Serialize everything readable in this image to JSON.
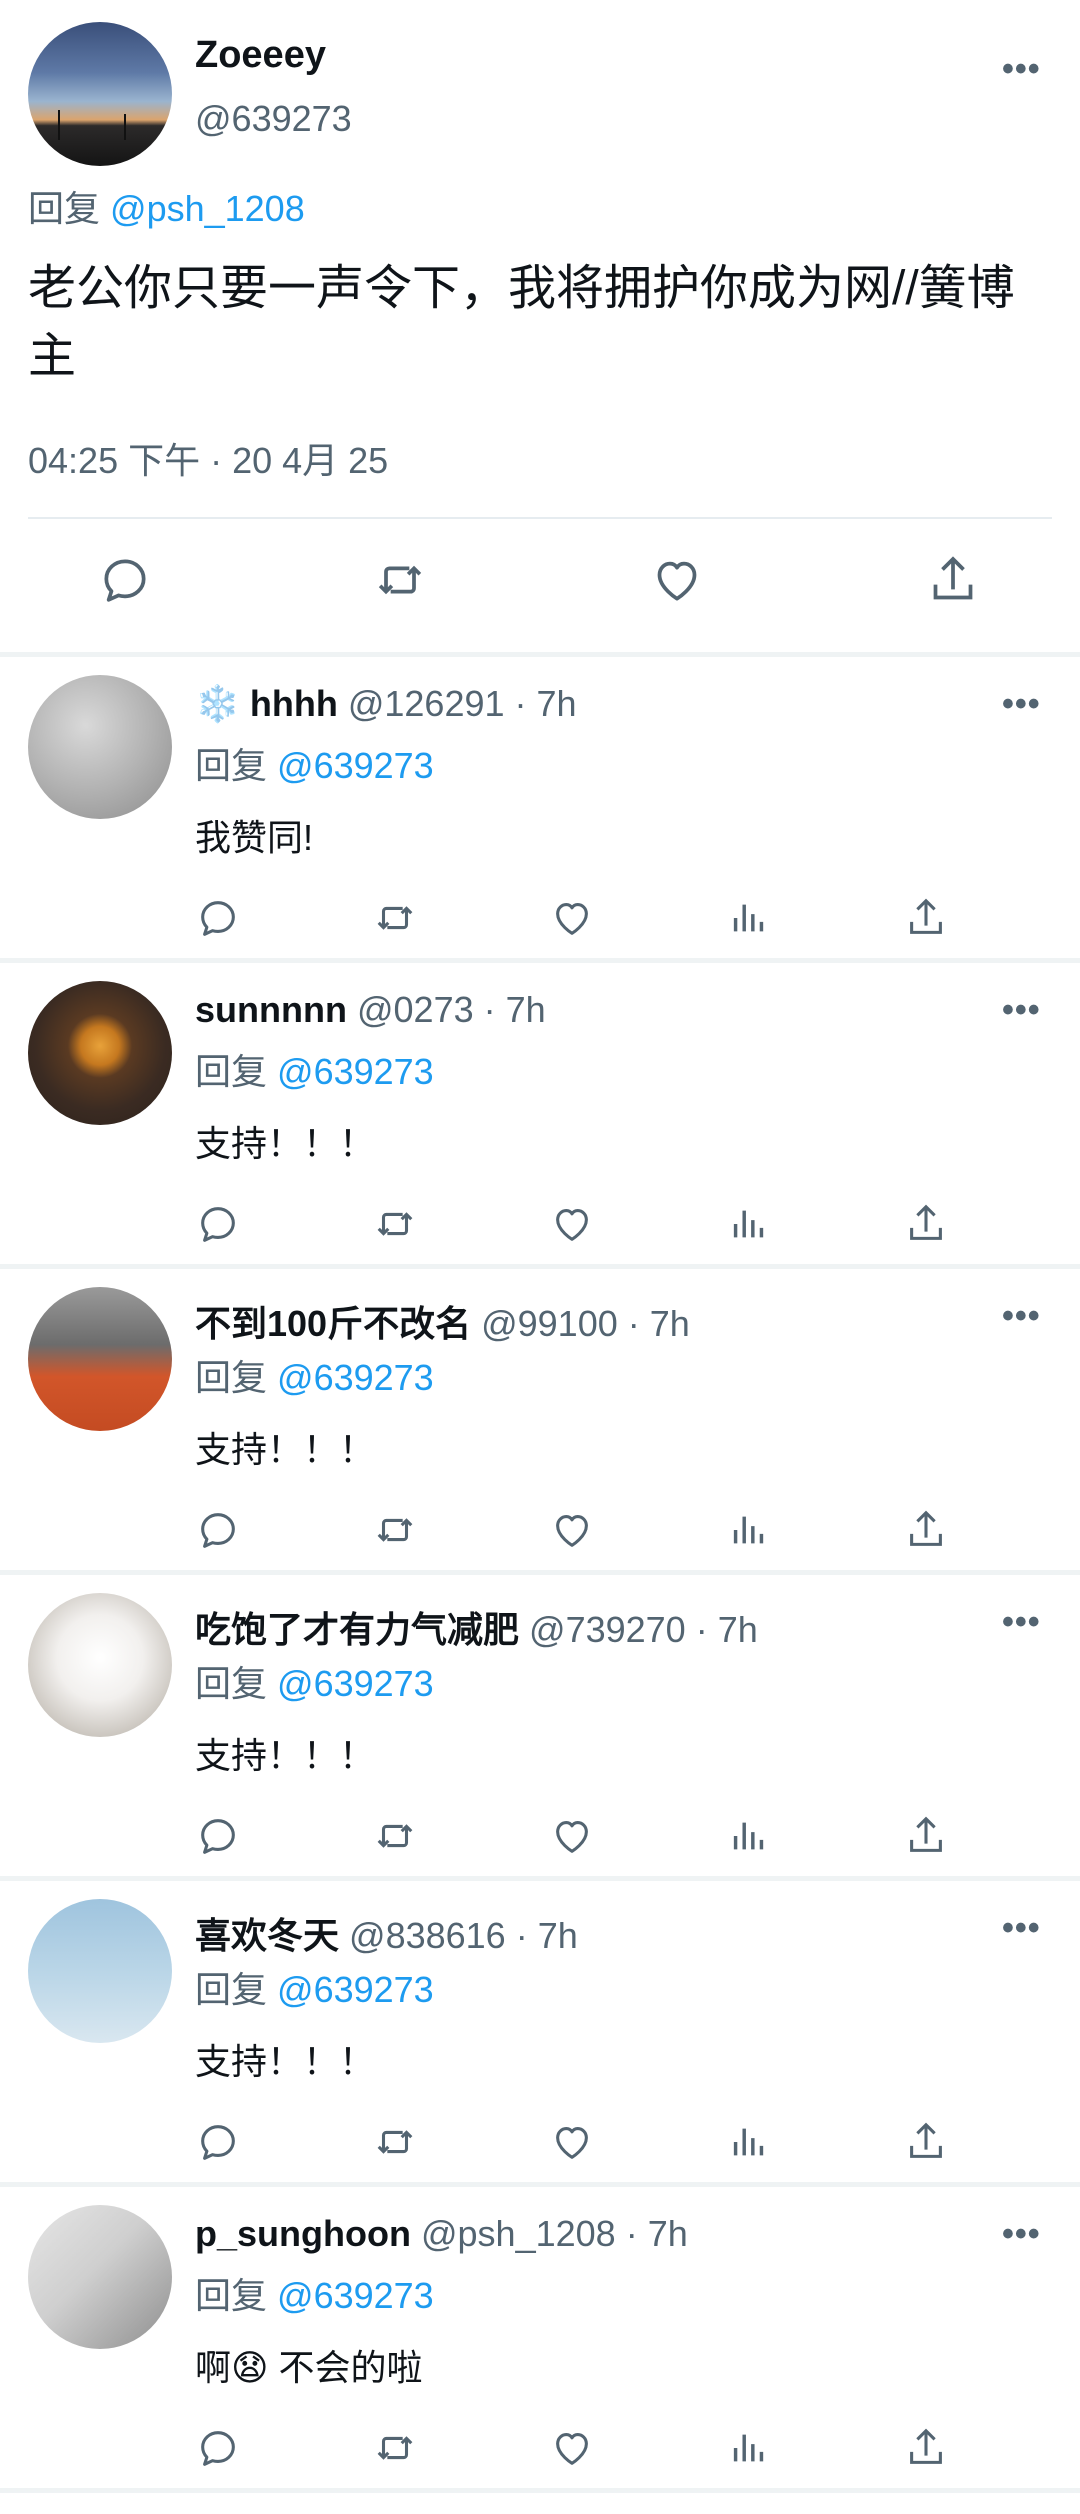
{
  "main_tweet": {
    "name": "Zoeeey",
    "handle": "@639273",
    "reply_prefix": "回复",
    "reply_to": "@psh_1208",
    "text": "老公你只要一声令下，我将拥护你成为网//簧博主",
    "timestamp": "04:25 下午 · 20 4月 25",
    "more_label": "•••"
  },
  "replies": [
    {
      "icon_prefix": "❄️",
      "name": "hhhh",
      "handle": "@126291",
      "time": "· 7h",
      "reply_prefix": "回复",
      "reply_to": "@639273",
      "text": "我赞同!",
      "more_label": "•••"
    },
    {
      "icon_prefix": "",
      "name": "sunnnnn",
      "handle": "@0273",
      "time": "· 7h",
      "reply_prefix": "回复",
      "reply_to": "@639273",
      "text": "支持！！！",
      "more_label": "•••"
    },
    {
      "icon_prefix": "",
      "name": "不到100斤不改名",
      "handle": "@99100",
      "time": "· 7h",
      "reply_prefix": "回复",
      "reply_to": "@639273",
      "text": "支持！！！",
      "more_label": "•••"
    },
    {
      "icon_prefix": "",
      "name": "吃饱了才有力气减肥",
      "handle": "@739270",
      "time": "· 7h",
      "reply_prefix": "回复",
      "reply_to": "@639273",
      "text": "支持！！！",
      "more_label": "•••"
    },
    {
      "icon_prefix": "",
      "name": "喜欢冬天",
      "handle": "@838616",
      "time": "· 7h",
      "reply_prefix": "回复",
      "reply_to": "@639273",
      "text": "支持！！！",
      "more_label": "•••"
    },
    {
      "icon_prefix": "",
      "name": "p_sunghoon",
      "handle": "@psh_1208",
      "time": "· 7h",
      "reply_prefix": "回复",
      "reply_to": "@639273",
      "text": "啊😧 不会的啦",
      "more_label": "•••"
    }
  ],
  "icons": {
    "reply": "reply-icon",
    "retweet": "retweet-icon",
    "like": "heart-icon",
    "views": "views-icon",
    "share": "share-icon",
    "more": "more-icon"
  },
  "colors": {
    "link": "#1d9bf0",
    "secondary_text": "#536471",
    "divider": "#eff3f4"
  }
}
